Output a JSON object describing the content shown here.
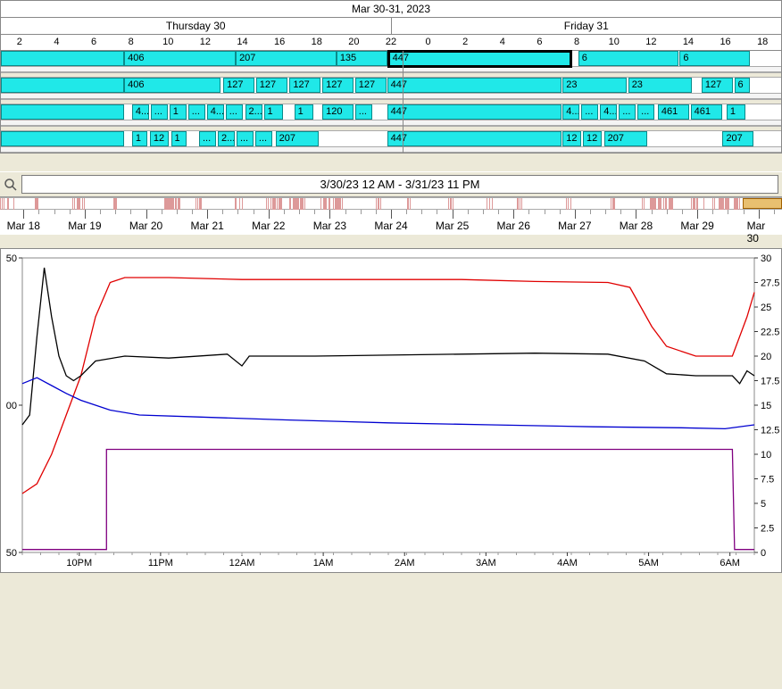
{
  "gantt": {
    "title": "Mar 30-31, 2023",
    "days": [
      "Thursday 30",
      "Friday 31"
    ],
    "hours": [
      2,
      4,
      6,
      8,
      10,
      12,
      14,
      16,
      18,
      20,
      22,
      0,
      2,
      4,
      6,
      8,
      10,
      12,
      14,
      16,
      18
    ],
    "day_split_pct": 51.5,
    "rows": [
      {
        "blocks": [
          {
            "l": 0,
            "w": 15.8,
            "t": "",
            "sel": false
          },
          {
            "l": 15.8,
            "w": 14.3,
            "t": "406",
            "sel": false
          },
          {
            "l": 30.1,
            "w": 12.9,
            "t": "207",
            "sel": false
          },
          {
            "l": 43,
            "w": 6.5,
            "t": "135",
            "sel": false
          },
          {
            "l": 49.5,
            "w": 23.7,
            "t": "447",
            "sel": true
          },
          {
            "l": 74,
            "w": 12.8,
            "t": "6",
            "sel": false
          },
          {
            "l": 87,
            "w": 9,
            "t": "6",
            "sel": false
          }
        ]
      },
      {
        "blocks": [
          {
            "l": 0,
            "w": 15.8,
            "t": "",
            "sel": false
          },
          {
            "l": 15.8,
            "w": 12.4,
            "t": "406",
            "sel": false
          },
          {
            "l": 28.5,
            "w": 4,
            "t": "127",
            "sel": false
          },
          {
            "l": 32.7,
            "w": 4,
            "t": "127",
            "sel": false
          },
          {
            "l": 37,
            "w": 4,
            "t": "127",
            "sel": false
          },
          {
            "l": 41.2,
            "w": 4,
            "t": "127",
            "sel": false
          },
          {
            "l": 45.4,
            "w": 4,
            "t": "127",
            "sel": false
          },
          {
            "l": 49.5,
            "w": 22.3,
            "t": "447",
            "sel": false
          },
          {
            "l": 72,
            "w": 8.2,
            "t": "23",
            "sel": false
          },
          {
            "l": 80.4,
            "w": 8.2,
            "t": "23",
            "sel": false
          },
          {
            "l": 89.8,
            "w": 4,
            "t": "127",
            "sel": false
          },
          {
            "l": 94,
            "w": 2,
            "t": "6",
            "sel": false
          }
        ]
      },
      {
        "blocks": [
          {
            "l": 0,
            "w": 15.8,
            "t": "",
            "sel": false
          },
          {
            "l": 16.8,
            "w": 2.2,
            "t": "4...",
            "sel": false
          },
          {
            "l": 19.2,
            "w": 2.2,
            "t": "...",
            "sel": false
          },
          {
            "l": 21.6,
            "w": 2.2,
            "t": "1",
            "sel": false
          },
          {
            "l": 24,
            "w": 2.2,
            "t": "...",
            "sel": false
          },
          {
            "l": 26.4,
            "w": 2.2,
            "t": "4...",
            "sel": false
          },
          {
            "l": 28.8,
            "w": 2.2,
            "t": "...",
            "sel": false
          },
          {
            "l": 31.3,
            "w": 2.2,
            "t": "2...",
            "sel": false
          },
          {
            "l": 33.7,
            "w": 2.5,
            "t": "1",
            "sel": false
          },
          {
            "l": 37.6,
            "w": 2.5,
            "t": "1",
            "sel": false
          },
          {
            "l": 41.2,
            "w": 4,
            "t": "120",
            "sel": false
          },
          {
            "l": 45.4,
            "w": 2.2,
            "t": "...",
            "sel": false
          },
          {
            "l": 49.5,
            "w": 22.3,
            "t": "447",
            "sel": false
          },
          {
            "l": 72,
            "w": 2.2,
            "t": "4...",
            "sel": false
          },
          {
            "l": 74.4,
            "w": 2.2,
            "t": "...",
            "sel": false
          },
          {
            "l": 76.8,
            "w": 2.2,
            "t": "4...",
            "sel": false
          },
          {
            "l": 79.2,
            "w": 2.2,
            "t": "...",
            "sel": false
          },
          {
            "l": 81.6,
            "w": 2.2,
            "t": "...",
            "sel": false
          },
          {
            "l": 84.2,
            "w": 4,
            "t": "461",
            "sel": false
          },
          {
            "l": 88.4,
            "w": 4,
            "t": "461",
            "sel": false
          },
          {
            "l": 93,
            "w": 2.4,
            "t": "1",
            "sel": false
          }
        ]
      },
      {
        "blocks": [
          {
            "l": 0,
            "w": 15.8,
            "t": "",
            "sel": false
          },
          {
            "l": 16.8,
            "w": 2,
            "t": "1",
            "sel": false
          },
          {
            "l": 19.1,
            "w": 2.4,
            "t": "12",
            "sel": false
          },
          {
            "l": 21.8,
            "w": 2,
            "t": "1",
            "sel": false
          },
          {
            "l": 25.4,
            "w": 2.2,
            "t": "...",
            "sel": false
          },
          {
            "l": 27.8,
            "w": 2.2,
            "t": "2...",
            "sel": false
          },
          {
            "l": 30.2,
            "w": 2.2,
            "t": "...",
            "sel": false
          },
          {
            "l": 32.6,
            "w": 2.2,
            "t": "...",
            "sel": false
          },
          {
            "l": 35.2,
            "w": 5.5,
            "t": "207",
            "sel": false
          },
          {
            "l": 49.5,
            "w": 22.3,
            "t": "447",
            "sel": false
          },
          {
            "l": 72,
            "w": 2.4,
            "t": "12",
            "sel": false
          },
          {
            "l": 74.6,
            "w": 2.4,
            "t": "12",
            "sel": false
          },
          {
            "l": 77.3,
            "w": 5.5,
            "t": "207",
            "sel": false
          },
          {
            "l": 92.5,
            "w": 4,
            "t": "207",
            "sel": false
          }
        ]
      }
    ]
  },
  "search": {
    "value": "3/30/23 12 AM - 3/31/23 11 PM"
  },
  "timeline": {
    "labels": [
      "Mar 18",
      "Mar 19",
      "Mar 20",
      "Mar 21",
      "Mar 22",
      "Mar 23",
      "Mar 24",
      "Mar 25",
      "Mar 26",
      "Mar 27",
      "Mar 28",
      "Mar 29",
      "Mar 30"
    ],
    "highlight": {
      "l": 95,
      "w": 5
    }
  },
  "chart_data": {
    "type": "line",
    "xlabel": "",
    "xticks": [
      "10PM",
      "11PM",
      "12AM",
      "1AM",
      "2AM",
      "3AM",
      "4AM",
      "5AM",
      "6AM"
    ],
    "left_axis": {
      "min": -50,
      "max": 50,
      "ticks": [
        50,
        0,
        -50
      ],
      "tick_labels": [
        "50",
        "00",
        "50"
      ]
    },
    "right_axis": {
      "min": 0,
      "max": 30,
      "ticks": [
        0,
        2.5,
        5,
        7.5,
        10,
        12.5,
        15,
        17.5,
        20,
        22.5,
        25,
        27.5,
        30
      ]
    },
    "series": [
      {
        "name": "red",
        "color": "#e00000",
        "axis": "right",
        "points": [
          [
            0,
            6
          ],
          [
            2,
            7
          ],
          [
            4,
            10
          ],
          [
            6,
            14
          ],
          [
            8,
            18
          ],
          [
            10,
            24
          ],
          [
            12,
            27.5
          ],
          [
            14,
            28
          ],
          [
            20,
            28
          ],
          [
            30,
            27.8
          ],
          [
            40,
            27.8
          ],
          [
            50,
            27.8
          ],
          [
            60,
            27.8
          ],
          [
            70,
            27.6
          ],
          [
            80,
            27.5
          ],
          [
            83,
            27
          ],
          [
            86,
            23
          ],
          [
            88,
            21
          ],
          [
            92,
            20
          ],
          [
            97,
            20
          ],
          [
            99,
            24
          ],
          [
            100,
            26.5
          ]
        ]
      },
      {
        "name": "black",
        "color": "#000000",
        "axis": "right",
        "points": [
          [
            0,
            13
          ],
          [
            1,
            14
          ],
          [
            2,
            22
          ],
          [
            3,
            29
          ],
          [
            4,
            24
          ],
          [
            5,
            20
          ],
          [
            6,
            18
          ],
          [
            7,
            17.5
          ],
          [
            8,
            18
          ],
          [
            10,
            19.5
          ],
          [
            14,
            20
          ],
          [
            20,
            19.8
          ],
          [
            28,
            20.2
          ],
          [
            30,
            19
          ],
          [
            31,
            20
          ],
          [
            40,
            20
          ],
          [
            50,
            20.1
          ],
          [
            60,
            20.2
          ],
          [
            70,
            20.3
          ],
          [
            80,
            20.2
          ],
          [
            85,
            19.5
          ],
          [
            88,
            18.2
          ],
          [
            92,
            18
          ],
          [
            97,
            18
          ],
          [
            98,
            17.2
          ],
          [
            99,
            18.5
          ],
          [
            100,
            18
          ]
        ]
      },
      {
        "name": "blue",
        "color": "#0000d0",
        "axis": "right",
        "points": [
          [
            0,
            17.2
          ],
          [
            2,
            17.8
          ],
          [
            4,
            17
          ],
          [
            6,
            16.2
          ],
          [
            8,
            15.5
          ],
          [
            10,
            15
          ],
          [
            12,
            14.5
          ],
          [
            16,
            14
          ],
          [
            24,
            13.8
          ],
          [
            36,
            13.5
          ],
          [
            50,
            13.2
          ],
          [
            64,
            13
          ],
          [
            78,
            12.8
          ],
          [
            90,
            12.7
          ],
          [
            96,
            12.6
          ],
          [
            100,
            13
          ]
        ]
      },
      {
        "name": "purple",
        "color": "#800080",
        "axis": "right",
        "points": [
          [
            0,
            0.3
          ],
          [
            6,
            0.3
          ],
          [
            10,
            0.3
          ],
          [
            11.5,
            0.3
          ],
          [
            11.5,
            10.5
          ],
          [
            50,
            10.5
          ],
          [
            90,
            10.5
          ],
          [
            97,
            10.5
          ],
          [
            97.3,
            0.3
          ],
          [
            100,
            0.3
          ]
        ]
      }
    ]
  }
}
